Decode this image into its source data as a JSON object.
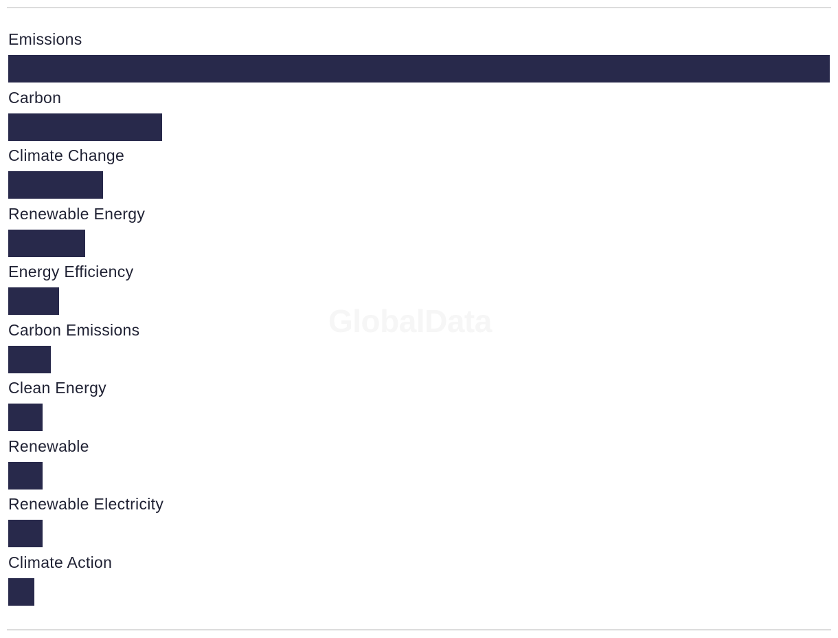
{
  "watermark": "GlobalData",
  "colors": {
    "bar": "#28294b",
    "text": "#1f2133",
    "rule": "#dcdcdc"
  },
  "chart_data": {
    "type": "bar",
    "orientation": "horizontal",
    "title": "",
    "xlabel": "",
    "ylabel": "",
    "value_units": "relative (Emissions = 100)",
    "xlim": [
      0,
      100
    ],
    "grid": false,
    "legend": "none",
    "categories": [
      "Emissions",
      "Carbon",
      "Climate Change",
      "Renewable Energy",
      "Energy Efficiency",
      "Carbon Emissions",
      "Clean Energy",
      "Renewable",
      "Renewable Electricity",
      "Climate Action"
    ],
    "values": [
      100,
      18.7,
      11.5,
      9.4,
      6.2,
      5.2,
      4.2,
      4.2,
      4.2,
      3.2
    ]
  }
}
